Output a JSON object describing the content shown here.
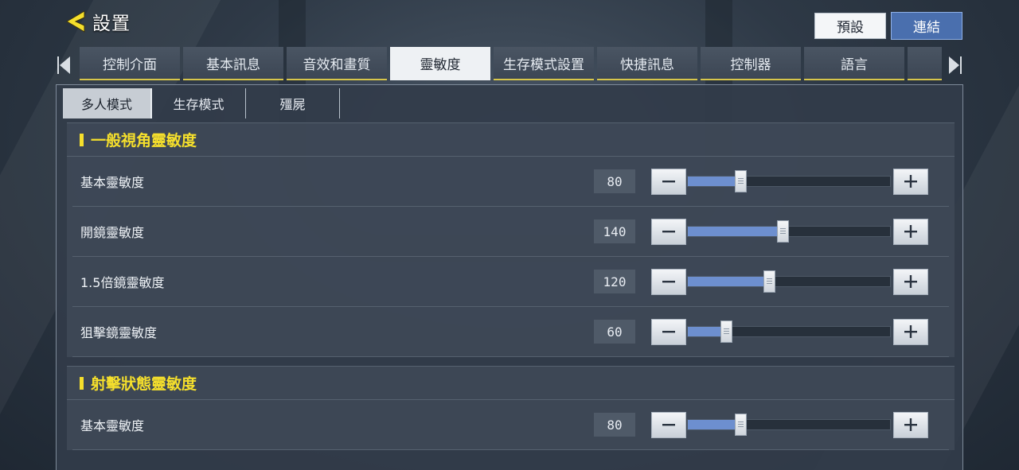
{
  "header": {
    "title": "設置",
    "preset_label": "預設",
    "link_label": "連結"
  },
  "tabs": [
    {
      "label": "控制介面",
      "active": false
    },
    {
      "label": "基本訊息",
      "active": false
    },
    {
      "label": "音效和畫質",
      "active": false
    },
    {
      "label": "靈敏度",
      "active": true
    },
    {
      "label": "生存模式設置",
      "active": false
    },
    {
      "label": "快捷訊息",
      "active": false
    },
    {
      "label": "控制器",
      "active": false
    },
    {
      "label": "語言",
      "active": false
    },
    {
      "label": "",
      "active": false
    }
  ],
  "subtabs": [
    {
      "label": "多人模式",
      "active": true
    },
    {
      "label": "生存模式",
      "active": false
    },
    {
      "label": "殭屍",
      "active": false
    }
  ],
  "sections": [
    {
      "title": "一般視角靈敏度",
      "rows": [
        {
          "label": "基本靈敏度",
          "value": "80",
          "fraction": 0.26
        },
        {
          "label": "開鏡靈敏度",
          "value": "140",
          "fraction": 0.47
        },
        {
          "label": "1.5倍鏡靈敏度",
          "value": "120",
          "fraction": 0.4
        },
        {
          "label": "狙擊鏡靈敏度",
          "value": "60",
          "fraction": 0.19
        }
      ]
    },
    {
      "title": "射擊狀態靈敏度",
      "rows": [
        {
          "label": "基本靈敏度",
          "value": "80",
          "fraction": 0.26
        }
      ]
    }
  ],
  "colors": {
    "accent_yellow": "#f5df2c",
    "link_blue": "#4a6fae",
    "slider_fill": "#6d8fcf"
  },
  "icons": {
    "back": "chevron-left-icon",
    "minus": "minus-icon",
    "plus": "plus-icon",
    "tab_left": "triangle-left-icon",
    "tab_right": "triangle-right-icon"
  }
}
